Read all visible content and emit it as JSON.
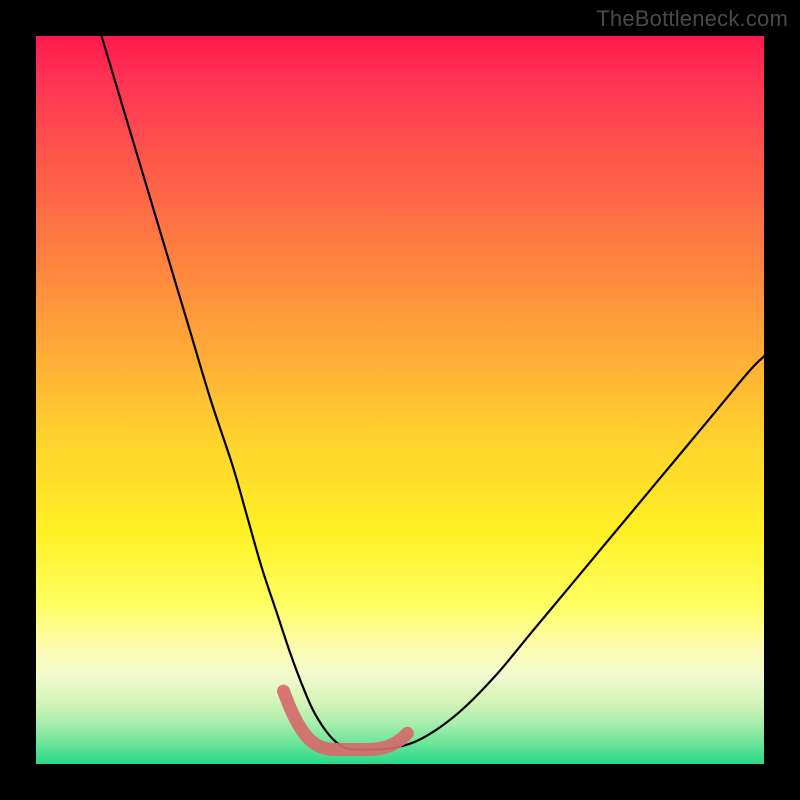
{
  "watermark": {
    "text": "TheBottleneck.com"
  },
  "chart_data": {
    "type": "line",
    "title": "",
    "xlabel": "",
    "ylabel": "",
    "xlim": [
      0,
      100
    ],
    "ylim": [
      0,
      100
    ],
    "grid": false,
    "legend": false,
    "series": [
      {
        "name": "bottleneck-curve",
        "x": [
          9,
          12,
          15,
          18,
          21,
          24,
          27,
          29,
          31,
          33,
          35,
          36.5,
          38,
          39.5,
          41,
          42.5,
          44,
          46,
          49,
          53,
          58,
          63,
          68,
          73,
          78,
          83,
          88,
          93,
          98,
          100
        ],
        "y": [
          100,
          90,
          80,
          70,
          60,
          50,
          41,
          34,
          27,
          21,
          15,
          11,
          7.5,
          5,
          3.2,
          2.2,
          2,
          2,
          2.2,
          3.5,
          7,
          12,
          18,
          24,
          30,
          36,
          42,
          48,
          54,
          56
        ]
      },
      {
        "name": "optimal-range-highlight",
        "x": [
          34,
          35,
          36,
          37,
          38,
          39,
          40,
          41,
          42,
          43,
          44,
          45,
          46,
          47,
          48,
          49,
          50,
          51
        ],
        "y": [
          10,
          7.5,
          5.5,
          4,
          3,
          2.4,
          2.1,
          2,
          2,
          2,
          2,
          2,
          2,
          2.1,
          2.3,
          2.7,
          3.3,
          4.2
        ]
      }
    ],
    "colors": {
      "curve": "#000000",
      "highlight": "#d66a6a",
      "gradient_top": "#ff1a4d",
      "gradient_mid": "#ffe030",
      "gradient_bottom": "#28d98a"
    }
  }
}
